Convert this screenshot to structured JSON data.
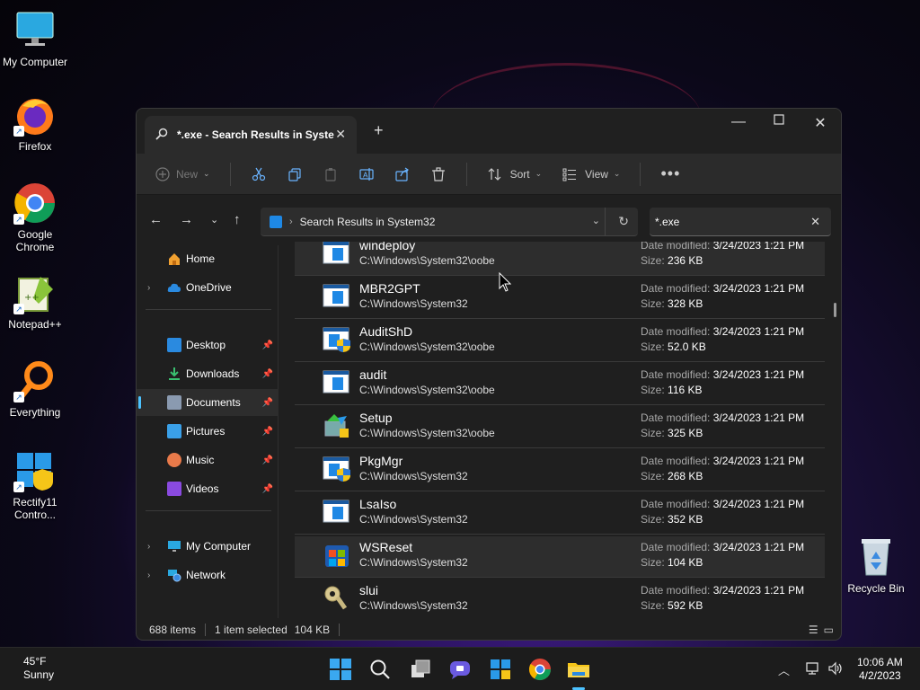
{
  "desktop": {
    "icons": [
      {
        "label": "My Computer"
      },
      {
        "label": "Firefox"
      },
      {
        "label": "Google Chrome"
      },
      {
        "label": "Notepad++"
      },
      {
        "label": "Everything"
      },
      {
        "label": "Rectify11 Contro..."
      },
      {
        "label": "Recycle Bin"
      }
    ]
  },
  "window": {
    "tab_title": "*.exe - Search Results in Syste",
    "toolbar": {
      "new_label": "New",
      "sort_label": "Sort",
      "view_label": "View"
    },
    "address": {
      "location": "Search Results in System32"
    },
    "search": {
      "value": "*.exe"
    },
    "nav": {
      "home": "Home",
      "onedrive": "OneDrive",
      "desktop": "Desktop",
      "downloads": "Downloads",
      "documents": "Documents",
      "pictures": "Pictures",
      "music": "Music",
      "videos": "Videos",
      "mycomputer": "My Computer",
      "network": "Network"
    },
    "labels": {
      "date_modified": "Date modified:",
      "size": "Size:"
    },
    "files": [
      {
        "name": "windeploy",
        "path": "C:\\Windows\\System32\\oobe",
        "date": "3/24/2023 1:21 PM",
        "size": "236 KB"
      },
      {
        "name": "MBR2GPT",
        "path": "C:\\Windows\\System32",
        "date": "3/24/2023 1:21 PM",
        "size": "328 KB"
      },
      {
        "name": "AuditShD",
        "path": "C:\\Windows\\System32\\oobe",
        "date": "3/24/2023 1:21 PM",
        "size": "52.0 KB"
      },
      {
        "name": "audit",
        "path": "C:\\Windows\\System32\\oobe",
        "date": "3/24/2023 1:21 PM",
        "size": "116 KB"
      },
      {
        "name": "Setup",
        "path": "C:\\Windows\\System32\\oobe",
        "date": "3/24/2023 1:21 PM",
        "size": "325 KB"
      },
      {
        "name": "PkgMgr",
        "path": "C:\\Windows\\System32",
        "date": "3/24/2023 1:21 PM",
        "size": "268 KB"
      },
      {
        "name": "LsaIso",
        "path": "C:\\Windows\\System32",
        "date": "3/24/2023 1:21 PM",
        "size": "352 KB"
      },
      {
        "name": "WSReset",
        "path": "C:\\Windows\\System32",
        "date": "3/24/2023 1:21 PM",
        "size": "104 KB"
      },
      {
        "name": "slui",
        "path": "C:\\Windows\\System32",
        "date": "3/24/2023 1:21 PM",
        "size": "592 KB"
      }
    ],
    "status": {
      "item_count": "688 items",
      "selection": "1 item selected",
      "selection_size": "104 KB"
    }
  },
  "taskbar": {
    "weather_temp": "45°F",
    "weather_desc": "Sunny",
    "time": "10:06 AM",
    "date": "4/2/2023"
  },
  "colors": {
    "accent": "#4cc2ff",
    "folder_blue": "#1e88e5"
  }
}
